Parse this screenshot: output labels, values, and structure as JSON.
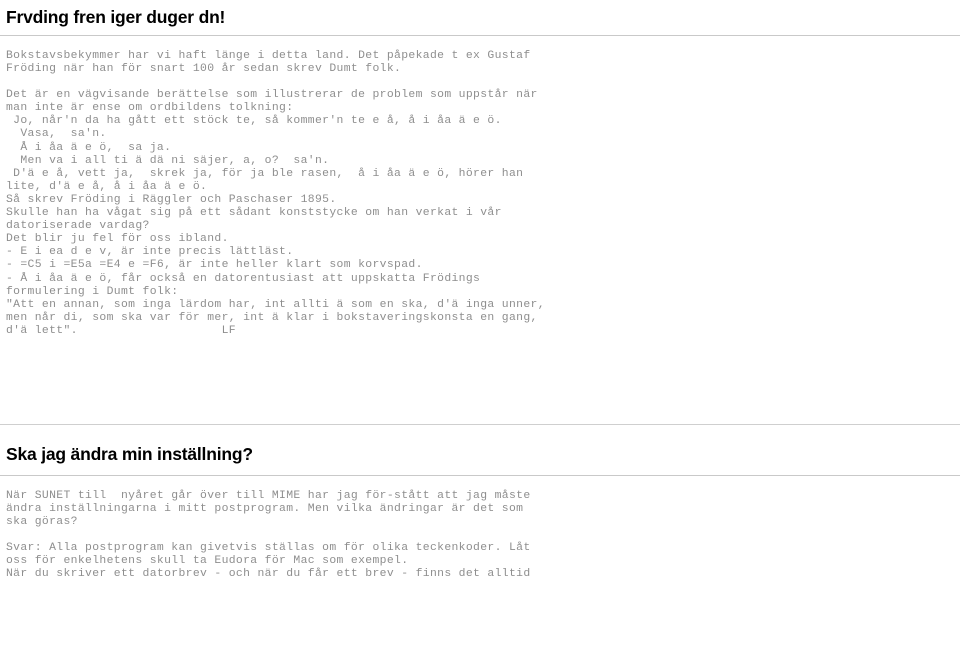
{
  "document": {
    "sections": [
      {
        "id": "frodings-folk",
        "heading": "Frvding fren iger duger dn!",
        "paragraphs": [
          "Bokstavsbekymmer har vi haft länge i detta land. Det påpekade t ex Gustaf\nFröding när han för snart 100 år sedan skrev Dumt folk.",
          "Det är en vägvisande berättelse som illustrerar de problem som uppstår när\nman inte är ense om ordbildens tolkning:\n Jo, når'n da ha gått ett stöck te, så kommer'n te e å, å i åa ä e ö.\n  Vasa,  sa'n.\n  Å i åa ä e ö,  sa ja.\n  Men va i all ti ä dä ni säjer, a, o?  sa'n.\n D'ä e å, vett ja,  skrek ja, för ja ble rasen,  å i åa ä e ö, hörer han\nlite, d'ä e å, å i åa ä e ö.\nSå skrev Fröding i Räggler och Paschaser 1895.\nSkulle han ha vågat sig på ett sådant konststycke om han verkat i vår\ndatoriserade vardag?\nDet blir ju fel för oss ibland.\n- E i ea d e v, är inte precis lättläst.\n- =C5 i =E5a =E4 e =F6, är inte heller klart som korvspad.\n- Å i åa ä e ö, får också en datorentusiast att uppskatta Frödings\nformulering i Dumt folk:\n\"Att en annan, som inga lärdom har, int allti ä som en ska, d'ä inga unner,\nmen når di, som ska var för mer, int ä klar i bokstaveringskonsta en gang,\nd'ä lett\".                    LF"
        ]
      },
      {
        "id": "andra-installning",
        "heading": "Ska jag ändra min inställning?",
        "paragraphs": [
          "När SUNET till  nyåret går över till MIME har jag för-stått att jag måste\nändra inställningarna i mitt postprogram. Men vilka ändringar är det som\nska göras?",
          "Svar: Alla postprogram kan givetvis ställas om för olika teckenkoder. Låt\noss för enkelhetens skull ta Eudora för Mac som exempel.\nNär du skriver ett datorbrev - och när du får ett brev - finns det alltid"
        ]
      }
    ],
    "signature": "LF",
    "colors": {
      "background": "#ffffff",
      "heading_text": "#000000",
      "body_text": "#8e8e8e",
      "rule": "#c9c9c9"
    }
  }
}
